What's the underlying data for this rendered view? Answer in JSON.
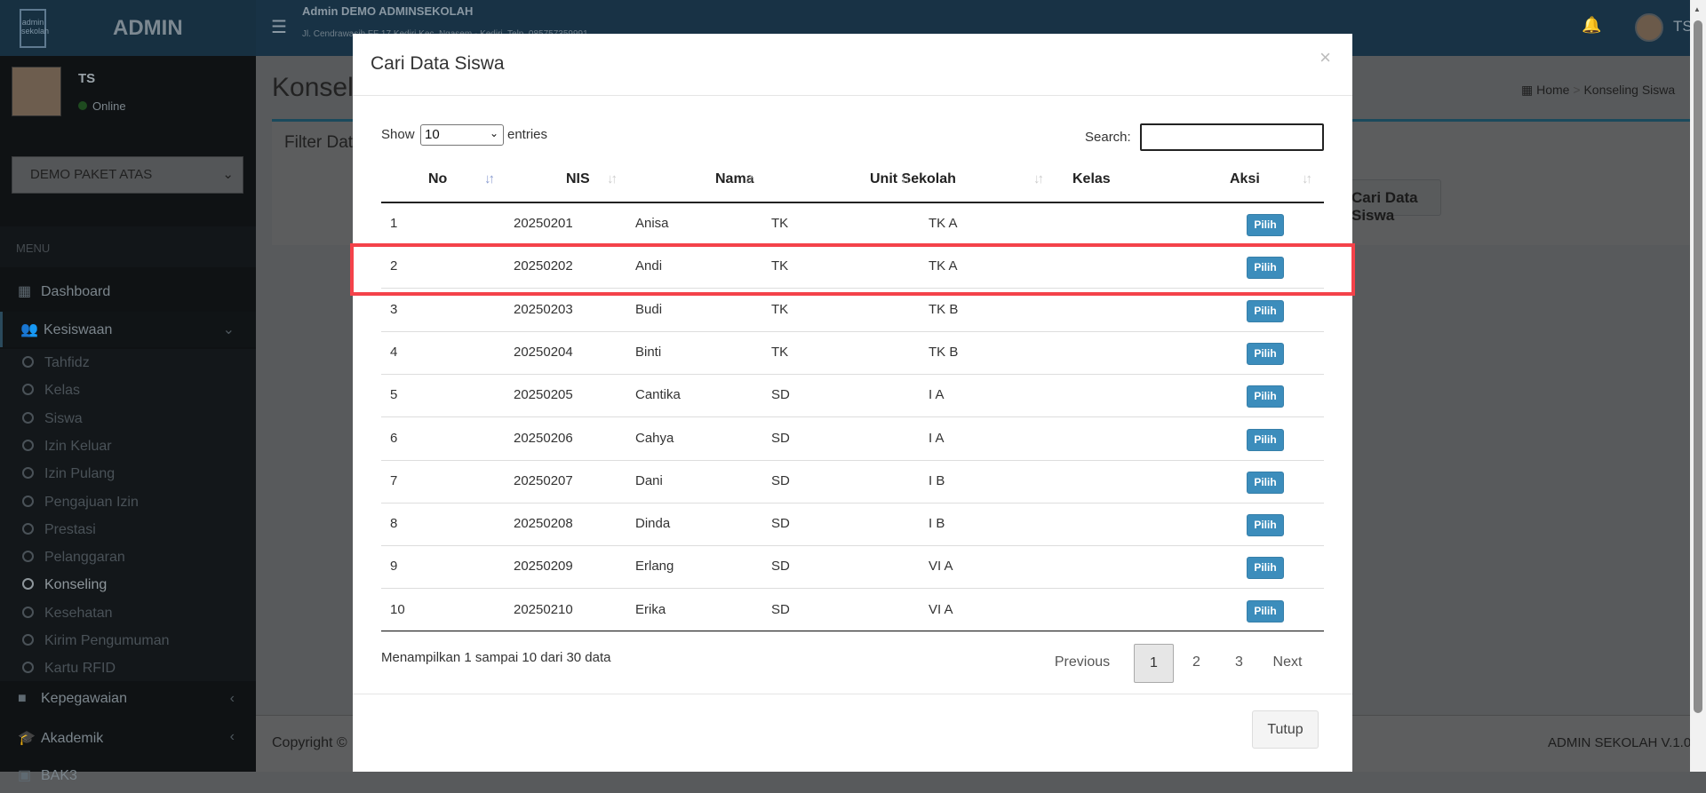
{
  "header": {
    "brand": "ADMIN",
    "logo_text": "admin sekolah .net",
    "school": "Admin DEMO ADMINSEKOLAH",
    "address": "Jl. Cendrawasih FF 17 Kediri Kec. Ngasem - Kediri, Telp. 085757359991",
    "user": "TS",
    "menu_icon": "bars-icon",
    "bell_icon": "bell-icon"
  },
  "sidebar": {
    "user": "TS",
    "status": "Online",
    "package": "DEMO PAKET ATAS",
    "menu_header": "MENU",
    "items": [
      {
        "label": "Dashboard",
        "icon": "dashboard-icon"
      },
      {
        "label": "Kesiswaan",
        "icon": "users-icon"
      },
      {
        "label": "Kepegawaian",
        "icon": "briefcase-icon"
      },
      {
        "label": "Akademik",
        "icon": "graduation-cap-icon"
      },
      {
        "label": "BAK3"
      }
    ],
    "sub": [
      "Tahfidz",
      "Kelas",
      "Siswa",
      "Izin Keluar",
      "Izin Pulang",
      "Pengajuan Izin",
      "Prestasi",
      "Pelanggaran",
      "Konseling",
      "Kesehatan",
      "Kirim Pengumuman",
      "Kartu RFID"
    ],
    "active": "Konseling"
  },
  "page": {
    "title": "Konseling Siswa",
    "breadcrumb": [
      "Home",
      "Konseling Siswa"
    ],
    "box_title": "Filter Data",
    "cari_button": "Cari Data Siswa",
    "copyright": "Copyright ©",
    "version": "ADMIN SEKOLAH V.1.0"
  },
  "modal": {
    "title": "Cari Data Siswa",
    "close": "×",
    "show": "Show",
    "entries": "entries",
    "length": "10",
    "search_label": "Search:",
    "search_value": "",
    "columns": [
      "No",
      "NIS",
      "Nama",
      "Unit Sekolah",
      "Kelas",
      "Aksi"
    ],
    "rows": [
      [
        "1",
        "20250201",
        "Anisa",
        "TK",
        "TK A",
        "Pilih"
      ],
      [
        "2",
        "20250202",
        "Andi",
        "TK",
        "TK A",
        "Pilih"
      ],
      [
        "3",
        "20250203",
        "Budi",
        "TK",
        "TK B",
        "Pilih"
      ],
      [
        "4",
        "20250204",
        "Binti",
        "TK",
        "TK B",
        "Pilih"
      ],
      [
        "5",
        "20250205",
        "Cantika",
        "SD",
        "I A",
        "Pilih"
      ],
      [
        "6",
        "20250206",
        "Cahya",
        "SD",
        "I A",
        "Pilih"
      ],
      [
        "7",
        "20250207",
        "Dani",
        "SD",
        "I B",
        "Pilih"
      ],
      [
        "8",
        "20250208",
        "Dinda",
        "SD",
        "I B",
        "Pilih"
      ],
      [
        "9",
        "20250209",
        "Erlang",
        "SD",
        "VI A",
        "Pilih"
      ],
      [
        "10",
        "20250210",
        "Erika",
        "SD",
        "VI A",
        "Pilih"
      ]
    ],
    "info": "Menampilkan 1 sampai 10 dari 30 data",
    "pagination": {
      "previous": "Previous",
      "pages": [
        "1",
        "2",
        "3"
      ],
      "current": "1",
      "next": "Next"
    },
    "close_button": "Tutup"
  },
  "colors": {
    "highlight": "#f4424a",
    "primary": "#3c8dbc"
  }
}
